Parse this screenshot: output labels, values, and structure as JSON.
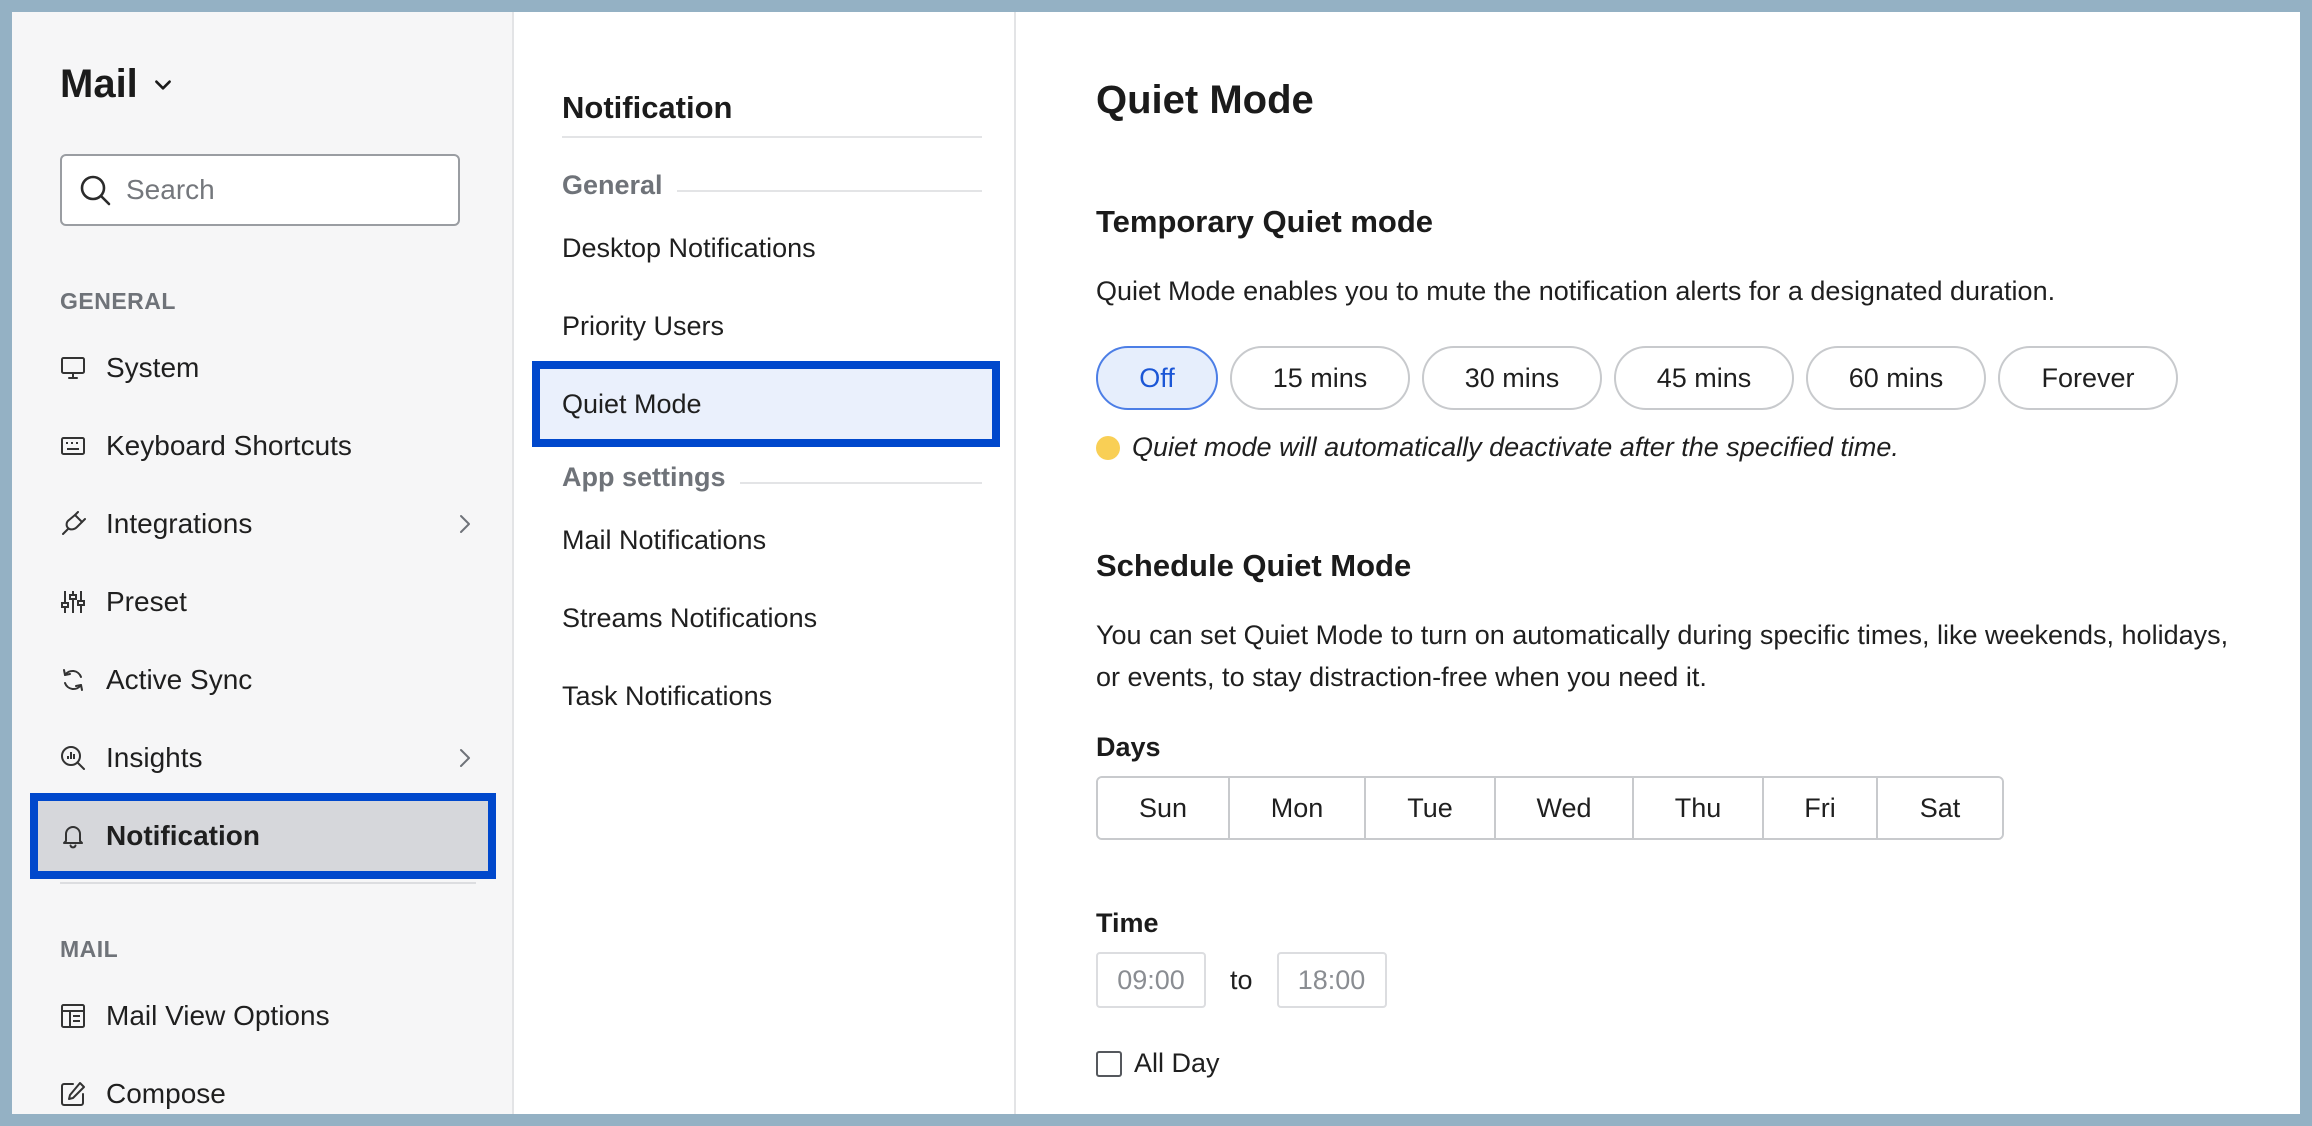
{
  "app": {
    "title": "Mail"
  },
  "search": {
    "placeholder": "Search"
  },
  "sidebar": {
    "general_label": "GENERAL",
    "mail_label": "MAIL",
    "items": [
      {
        "label": "System",
        "icon": "monitor-icon"
      },
      {
        "label": "Keyboard Shortcuts",
        "icon": "keyboard-icon"
      },
      {
        "label": "Integrations",
        "icon": "plug-icon",
        "has_arrow": true
      },
      {
        "label": "Preset",
        "icon": "sliders-icon"
      },
      {
        "label": "Active Sync",
        "icon": "sync-icon"
      },
      {
        "label": "Insights",
        "icon": "insights-icon",
        "has_arrow": true
      },
      {
        "label": "Notification",
        "icon": "bell-icon",
        "active": true
      }
    ],
    "mail_items": [
      {
        "label": "Mail View Options",
        "icon": "layout-icon"
      },
      {
        "label": "Compose",
        "icon": "compose-icon"
      }
    ]
  },
  "middle": {
    "title": "Notification",
    "general_group": "General",
    "general_items": [
      "Desktop Notifications",
      "Priority Users",
      "Quiet Mode"
    ],
    "app_group": "App settings",
    "app_items": [
      "Mail Notifications",
      "Streams Notifications",
      "Task Notifications"
    ],
    "active_item": "Quiet Mode"
  },
  "content": {
    "title": "Quiet Mode",
    "temp_heading": "Temporary Quiet mode",
    "temp_description": "Quiet Mode enables you to mute the notification alerts for a designated duration.",
    "durations": [
      "Off",
      "15 mins",
      "30 mins",
      "45 mins",
      "60 mins",
      "Forever"
    ],
    "selected_duration": "Off",
    "note": "Quiet mode will automatically deactivate after the specified time.",
    "schedule_heading": "Schedule Quiet Mode",
    "schedule_description": "You can set Quiet Mode to turn on automatically during specific times, like weekends, holidays, or events, to stay distraction-free when you need it.",
    "days_label": "Days",
    "days": [
      "Sun",
      "Mon",
      "Tue",
      "Wed",
      "Thu",
      "Fri",
      "Sat"
    ],
    "time_label": "Time",
    "time_start": "09:00",
    "time_separator": "to",
    "time_end": "18:00",
    "all_day_label": "All Day"
  },
  "colors": {
    "accent_border": "#0048cc",
    "selected_pill_bg": "#e6eefc",
    "selected_pill_text": "#1b56d6",
    "note_dot": "#f9cf55",
    "sidebar_bg": "#f6f6f7"
  }
}
